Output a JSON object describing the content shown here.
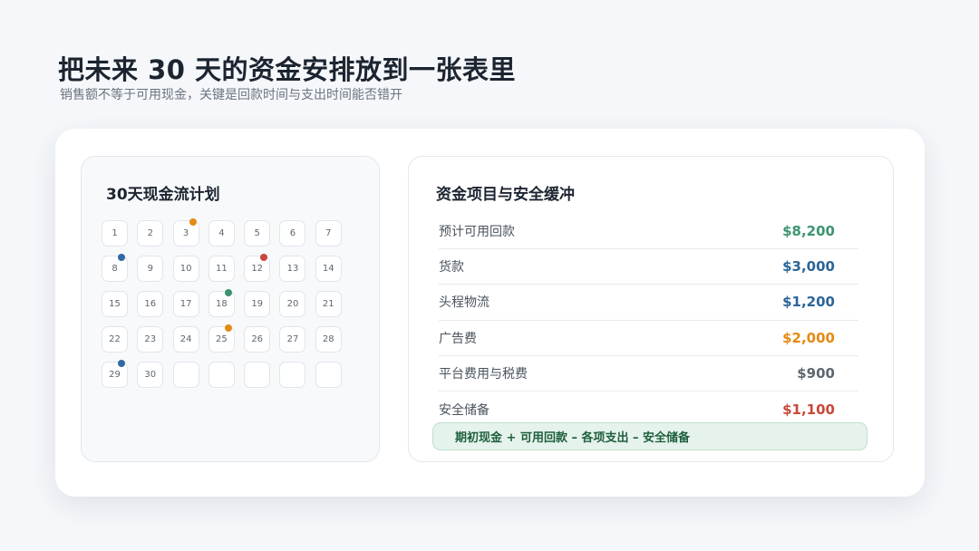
{
  "header": {
    "title": "把未来 30 天的资金安排放到一张表里",
    "subtitle": "销售额不等于可用现金，关键是回款时间与支出时间能否错开"
  },
  "calendar": {
    "title": "30天现金流计划",
    "days": [
      {
        "label": "1"
      },
      {
        "label": "2"
      },
      {
        "label": "3",
        "marker": "#e58a13"
      },
      {
        "label": "4"
      },
      {
        "label": "5"
      },
      {
        "label": "6"
      },
      {
        "label": "7"
      },
      {
        "label": "8",
        "marker": "#2f6aa3"
      },
      {
        "label": "9"
      },
      {
        "label": "10"
      },
      {
        "label": "11"
      },
      {
        "label": "12",
        "marker": "#c8483b"
      },
      {
        "label": "13"
      },
      {
        "label": "14"
      },
      {
        "label": "15"
      },
      {
        "label": "16"
      },
      {
        "label": "17"
      },
      {
        "label": "18",
        "marker": "#3d9470"
      },
      {
        "label": "19"
      },
      {
        "label": "20"
      },
      {
        "label": "21"
      },
      {
        "label": "22"
      },
      {
        "label": "23"
      },
      {
        "label": "24"
      },
      {
        "label": "25",
        "marker": "#e58a13"
      },
      {
        "label": "26"
      },
      {
        "label": "27"
      },
      {
        "label": "28"
      },
      {
        "label": "29",
        "marker": "#2f6aa3"
      },
      {
        "label": "30"
      },
      {
        "label": ""
      },
      {
        "label": ""
      },
      {
        "label": ""
      },
      {
        "label": ""
      },
      {
        "label": ""
      }
    ]
  },
  "funds": {
    "title": "资金项目与安全缓冲",
    "items": [
      {
        "label": "预计可用回款",
        "value": "$8,200",
        "color": "#3d9470"
      },
      {
        "label": "货款",
        "value": "$3,000",
        "color": "#2b6598"
      },
      {
        "label": "头程物流",
        "value": "$1,200",
        "color": "#2b6598"
      },
      {
        "label": "广告费",
        "value": "$2,000",
        "color": "#e58a13"
      },
      {
        "label": "平台费用与税费",
        "value": "$900",
        "color": "#5e6670"
      },
      {
        "label": "安全储备",
        "value": "$1,100",
        "color": "#c8483b"
      }
    ],
    "formula": "期初现金 + 可用回款 – 各项支出 – 安全储备"
  }
}
